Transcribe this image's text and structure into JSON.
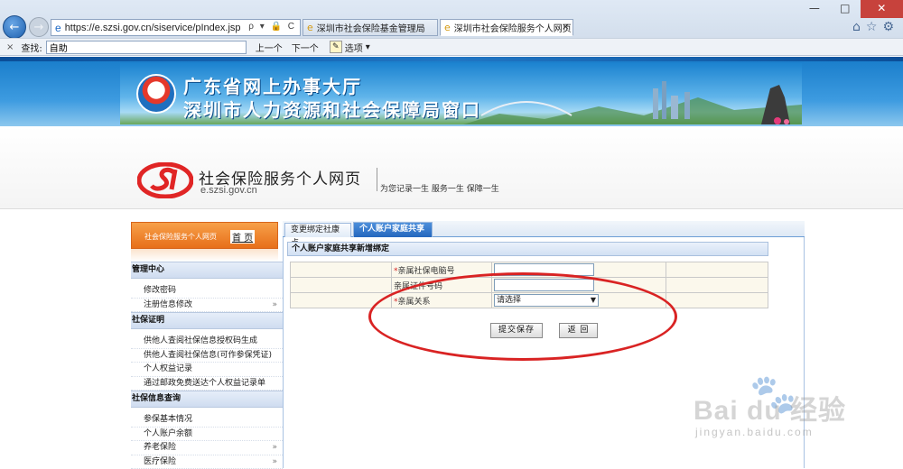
{
  "browser": {
    "address": "https://e.szsi.gov.cn/siservice/pIndex.jsp",
    "address_controls": "ρ ▾ 🔒 C",
    "tabs": [
      {
        "label": "深圳市社会保险基金管理局"
      },
      {
        "label": "深圳市社会保险服务个人网页"
      }
    ],
    "tab_close": "×",
    "window_controls": {
      "min": "—",
      "max": "□",
      "close": "✕"
    },
    "icons": [
      "home-icon",
      "star-icon",
      "gear-icon"
    ]
  },
  "findbar": {
    "close": "×",
    "label": "查找:",
    "value": "自助",
    "prev": "上一个",
    "next": "下一个",
    "options": "选项"
  },
  "banner": {
    "line1": "广东省网上办事大厅",
    "line2": "深圳市人力资源和社会保障局窗口"
  },
  "header": {
    "title": "社会保险服务个人网页",
    "domain": "e.szsi.gov.cn",
    "slogan": "为您记录一生  服务一生  保障一生"
  },
  "sidebar": {
    "head": "社会保险服务个人网页",
    "home": "首 页",
    "sections": [
      {
        "title": "管理中心",
        "items": [
          {
            "label": "修改密码",
            "chevron": ""
          },
          {
            "label": "注册信息修改",
            "chevron": "»"
          }
        ]
      },
      {
        "title": "社保证明",
        "items": [
          {
            "label": "供他人查阅社保信息授权码生成",
            "chevron": ""
          },
          {
            "label": "供他人查阅社保信息(可作参保凭证)",
            "chevron": ""
          },
          {
            "label": "个人权益记录",
            "chevron": ""
          },
          {
            "label": "通过邮政免费送达个人权益记录单",
            "chevron": ""
          }
        ]
      },
      {
        "title": "社保信息查询",
        "items": [
          {
            "label": "参保基本情况",
            "chevron": ""
          },
          {
            "label": "个人账户余额",
            "chevron": ""
          },
          {
            "label": "养老保险",
            "chevron": "»"
          },
          {
            "label": "医疗保险",
            "chevron": "»"
          }
        ]
      }
    ]
  },
  "content": {
    "tabs": [
      "变更绑定社康点",
      "个人账户家庭共享"
    ],
    "section_title": "个人账户家庭共享新增绑定",
    "form": {
      "required_mark": "*",
      "field1_label": "亲属社保电脑号",
      "field2_label": "亲属证件号码",
      "field3_label": "亲属关系",
      "field1_value": "",
      "field2_value": "",
      "select_value": "请选择",
      "select_arrow": "▼"
    },
    "buttons": {
      "save": "提交保存",
      "back": "返 回"
    }
  },
  "watermark": {
    "text": "Bai du 经验",
    "url": "jingyan.baidu.com"
  }
}
